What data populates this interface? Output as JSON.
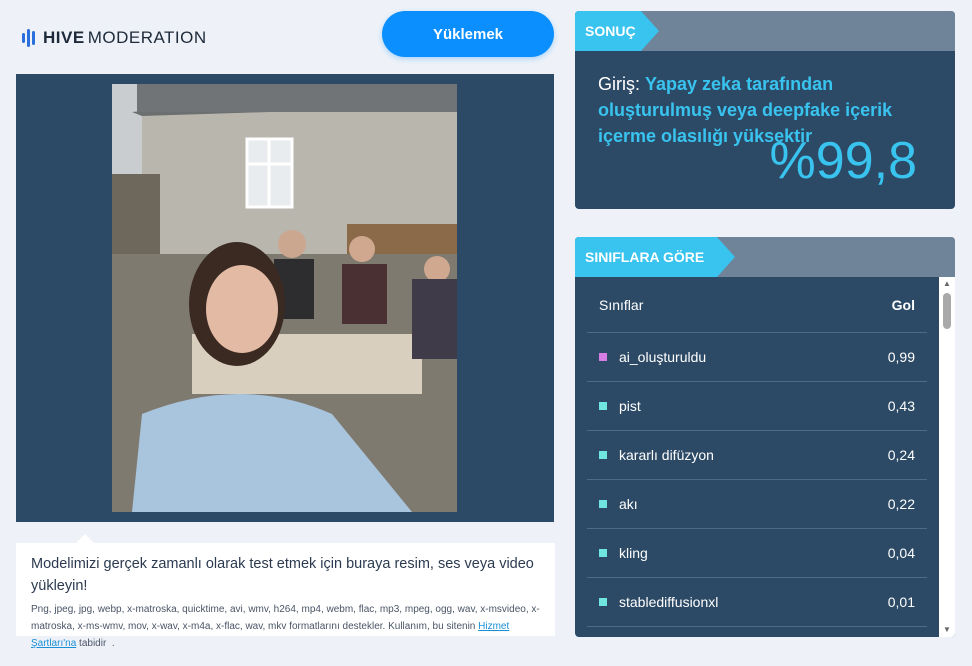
{
  "header": {
    "logo_bold": "HIVE",
    "logo_light": "MODERATION",
    "upload_label": "Yüklemek"
  },
  "upload_info": {
    "main": "Modelimizi gerçek zamanlı olarak test etmek için buraya resim, ses veya video yükleyin!",
    "formats": "Png, jpeg, jpg, webp, x-matroska, quicktime, avi, wmv, h264, mp4, webm, flac, mp3, mpeg, ogg, wav, x-msvideo, x-matroska, x-ms-wmv, mov, x-wav, x-m4a, x-flac, wav, mkv formatlarını destekler. Kullanım, bu sitenin",
    "terms_link": "Hizmet Şartları'na",
    "terms_suffix": " tabidir",
    "period": "."
  },
  "result": {
    "title": "SONUÇ",
    "prefix": "Giriş: ",
    "text": "Yapay zeka tarafından oluşturulmuş veya deepfake içerik içerme olasılığı yüksektir",
    "percent": "%99,8"
  },
  "classes": {
    "title": "SINIFLARA GÖRE",
    "col_class": "Sınıflar",
    "col_score": "Gol",
    "rows": [
      {
        "name": "ai_oluşturuldu",
        "score": "0,99",
        "color": "#d77ee6"
      },
      {
        "name": "pist",
        "score": "0,43",
        "color": "#6fe6e0"
      },
      {
        "name": "kararlı difüzyon",
        "score": "0,24",
        "color": "#6fe6e0"
      },
      {
        "name": "akı",
        "score": "0,22",
        "color": "#6fe6e0"
      },
      {
        "name": "kling",
        "score": "0,04",
        "color": "#6fe6e0"
      },
      {
        "name": "stablediffusionxl",
        "score": "0,01",
        "color": "#6fe6e0"
      }
    ]
  },
  "colors": {
    "accent": "#39c3ef",
    "button": "#0b8fff",
    "panel": "#2c4a66"
  }
}
